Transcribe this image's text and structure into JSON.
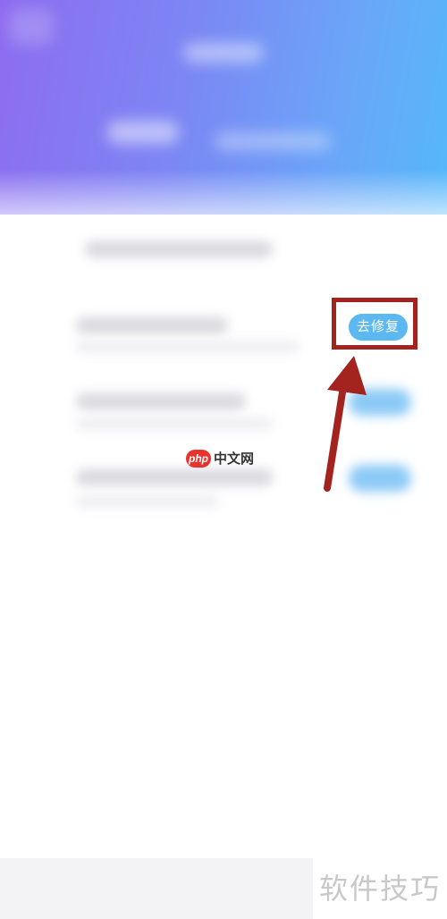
{
  "repair_button": {
    "label": "去修复"
  },
  "watermark": {
    "logo": "php",
    "text": "中文网"
  },
  "caption": {
    "text": "软件技巧"
  },
  "colors": {
    "header_start": "#8e6cf0",
    "header_end": "#55b8fa",
    "button": "#5cb8f1",
    "highlight": "#a3231f",
    "watermark_logo": "#e8322c"
  },
  "icons": {
    "annotation_arrow": "arrow-up-icon"
  }
}
